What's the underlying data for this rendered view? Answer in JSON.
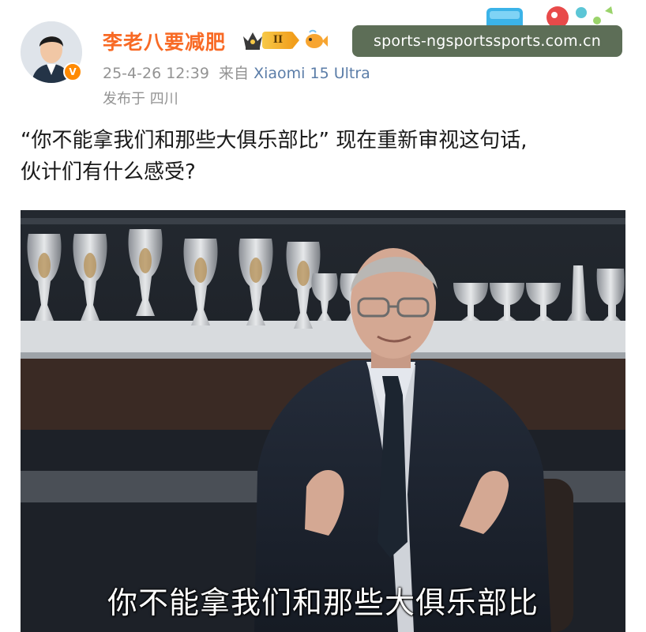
{
  "post": {
    "username": "李老八要减肥",
    "level_badge": "II",
    "date_time": "25-4-26 12:39",
    "source_prefix": "来自",
    "device": "Xiaomi 15 Ultra",
    "location": "发布于 四川",
    "text_line1": "“你不能拿我们和那些大俱乐部比” 现在重新审视这句话,",
    "text_line2": "伙计们有什么感受?"
  },
  "image": {
    "subtitle": "你不能拿我们和那些大俱乐部比"
  },
  "watermark": {
    "text": "sports-ngsportssports.com.cn"
  },
  "colors": {
    "username": "#f86a25",
    "meta": "#939393",
    "device": "#5b7da8",
    "watermark_bg": "#5d6e57",
    "verified_badge": "#ff8a00"
  },
  "icons": {
    "verified": "verified-v-icon",
    "vip_crown": "crown-icon",
    "fan_fish": "fish-icon",
    "festival_decoration": "festival-sticker-icon"
  }
}
